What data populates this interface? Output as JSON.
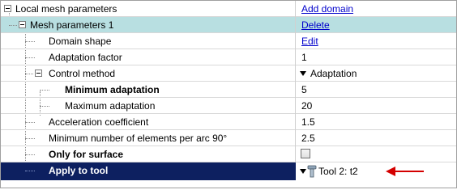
{
  "rows": [
    {
      "label": "Local mesh parameters",
      "value": "Add domain"
    },
    {
      "label": "Mesh parameters 1",
      "value": "Delete"
    },
    {
      "label": "Domain shape",
      "value": "Edit"
    },
    {
      "label": "Adaptation factor",
      "value": "1"
    },
    {
      "label": "Control method",
      "value": "Adaptation"
    },
    {
      "label": "Minimum adaptation",
      "value": "5"
    },
    {
      "label": "Maximum adaptation",
      "value": "20"
    },
    {
      "label": "Acceleration coefficient",
      "value": "1.5"
    },
    {
      "label": "Minimum number of elements per arc 90°",
      "value": "2.5"
    },
    {
      "label": "Only for surface",
      "value": ""
    },
    {
      "label": "Apply to tool",
      "value": "Tool 2: t2"
    }
  ],
  "colors": {
    "highlight_row": "#b8dfe1",
    "selected_row": "#0d2060",
    "link": "#0000cc",
    "annotation_arrow": "#d40000"
  },
  "icons": {
    "expander": "collapse-box-icon",
    "dropdown": "triangle-down-icon",
    "tool": "tool-icon",
    "annotation": "red-arrow-icon"
  }
}
